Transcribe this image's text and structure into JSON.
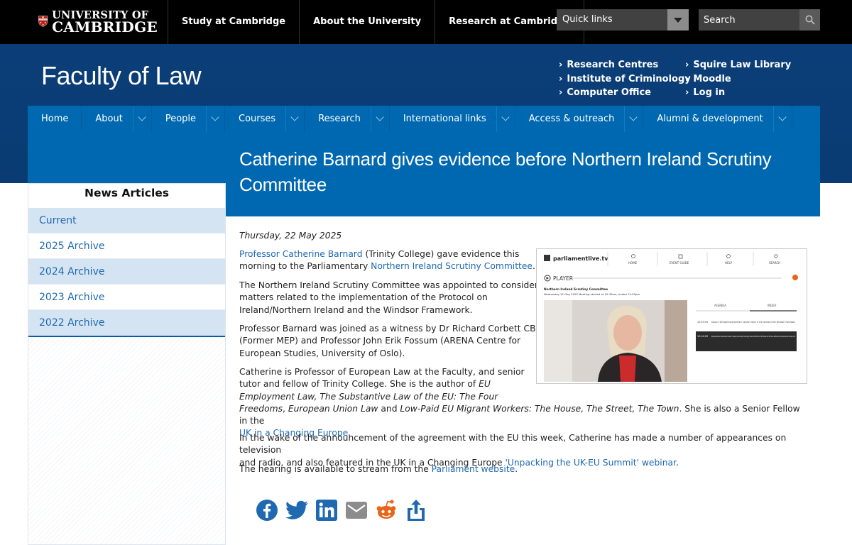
{
  "top": {
    "logo_line1": "UNIVERSITY OF",
    "logo_line2": "CAMBRIDGE",
    "nav": [
      "Study at Cambridge",
      "About the University",
      "Research at Cambridge"
    ],
    "quick_links": "Quick links",
    "search_placeholder": "Search"
  },
  "header": {
    "faculty": "Faculty of Law",
    "links_col1": [
      "Research Centres",
      "Institute of Criminology",
      "Computer Office"
    ],
    "links_col2": [
      "Squire Law Library",
      "Moodle",
      "Log in"
    ]
  },
  "mainnav": [
    "Home",
    "About",
    "People",
    "Courses",
    "Research",
    "International links",
    "Access & outreach",
    "Alumni & development"
  ],
  "page_title": "Catherine Barnard gives evidence before Northern Ireland Scrutiny Committee",
  "sidebar": {
    "heading": "News Articles",
    "items": [
      "Current",
      "2025 Archive",
      "2024 Archive",
      "2023 Archive",
      "2022 Archive"
    ]
  },
  "article": {
    "date": "Thursday, 22 May 2025",
    "p1_link1": "Professor Catherine Barnard",
    "p1_t1": " (Trinity College) gave evidence this",
    "p1_t2": "morning to the Parliamentary ",
    "p1_link2": "Northern Ireland Scrutiny Committee",
    "p1_t3": ".",
    "p2_l1": "The Northern Ireland Scrutiny Committee was appointed to consider",
    "p2_l2": "matters related to the implementation of the Protocol on",
    "p2_l3": "Ireland/Northern Ireland and the Windsor Framework.",
    "p3_l1": "Professor Barnard was joined as a witness by Dr Richard Corbett CBE",
    "p3_l2": "(Former MEP) and Professor John Erik Fossum (ARENA Centre for",
    "p3_l3": "European Studies, University of Oslo).",
    "p4_l1": "Catherine is Professor of European Law at the Faculty, and senior",
    "p4_l2": "tutor and fellow of Trinity College. She is the author of ",
    "p4_i1": "EU",
    "p4_i2": "Employment Law, The Substantive Law of the EU: The Four",
    "p4_i3": "Freedoms",
    "p4_t1": ", ",
    "p4_i4": "European Union Law",
    "p4_t2": " and ",
    "p4_i5": "Low-Paid EU Migrant Workers: The House, The Street, The Town",
    "p4_t3": ". She is also a Senior Fellow in the",
    "p4_link": "UK in a Changing Europe",
    "p4_t4": ".",
    "p5_l1": "In the wake of the announcement of the agreement with the EU this week, Catherine has made a number of appearances on television",
    "p5_t1": "and radio, and also featured in the UK in a Changing Europe ",
    "p5_link": "'Unpacking the UK-EU Summit' webinar",
    "p5_t2": ".",
    "p6_t1": "The hearing is available to stream from the ",
    "p6_link": "Parliament website",
    "p6_t2": "."
  },
  "thumbnail": {
    "site": "parliamentlive.tv",
    "tabs": [
      "HOME",
      "EVENT GUIDE",
      "HELP",
      "SEARCH"
    ],
    "player": "PLAYER",
    "meeting_title": "Northern Ireland Scrutiny Committee",
    "meeting_time": "Wednesday 21 May 2025 Meeting started at 10:43am, ended 12:05pm",
    "agenda": "AGENDA",
    "index": "INDEX",
    "entry1_time": "10:43:55",
    "entry1_text": "Subject: Strengthening Northern Ireland's Voice in the context of the Windsor Framework",
    "entry2_time": "10:44:00",
    "entry2_text": "Witness(es): Professor Catherine Barnard, Professor of European Law, University of Cambridge; Dr Richard Corbett CBE, Former MEP; Professor John Erik Fossum, ARENA Centre for European Studies, University of Oslo"
  },
  "share": [
    "facebook-icon",
    "twitter-icon",
    "linkedin-icon",
    "email-icon",
    "reddit-icon",
    "share-icon"
  ],
  "colors": {
    "top_bar": "#000000",
    "header_blue": "#0b3e78",
    "nav_blue": "#0068b0",
    "link_blue": "#1f69b0",
    "sidebar_shade": "#d5e4f2"
  }
}
